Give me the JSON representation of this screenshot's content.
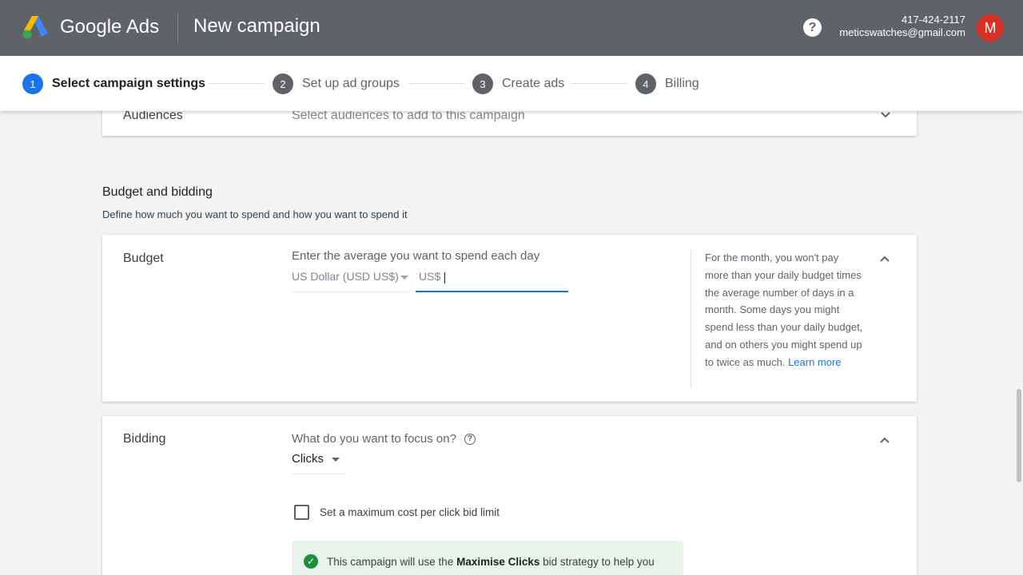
{
  "header": {
    "brand": "Google Ads",
    "page_title": "New campaign",
    "help_symbol": "?",
    "account_phone": "417-424-2117",
    "account_email": "meticswatches@gmail.com",
    "avatar_initial": "M",
    "colors": {
      "topbar": "#5f6368",
      "avatar": "#d93025"
    }
  },
  "stepper": {
    "steps": [
      {
        "number": "1",
        "label": "Select campaign settings",
        "active": true
      },
      {
        "number": "2",
        "label": "Set up ad groups",
        "active": false
      },
      {
        "number": "3",
        "label": "Create ads",
        "active": false
      },
      {
        "number": "4",
        "label": "Billing",
        "active": false
      }
    ],
    "accent": "#1a73e8"
  },
  "audiences": {
    "label": "Audiences",
    "placeholder": "Select audiences to add to this campaign"
  },
  "budget_bidding": {
    "title": "Budget and bidding",
    "subtitle": "Define how much you want to spend and how you want to spend it"
  },
  "budget": {
    "label": "Budget",
    "prompt": "Enter the average you want to spend each day",
    "currency_selected": "US Dollar (USD US$)",
    "input_prefix": "US$",
    "input_value": "",
    "help_text": "For the month, you won't pay more than your daily budget times the average number of days in a month. Some days you might spend less than your daily budget, and on others you might spend up to twice as much.",
    "learn_more": "Learn more"
  },
  "bidding": {
    "label": "Bidding",
    "focus_question": "What do you want to focus on?",
    "focus_help_symbol": "?",
    "focus_selected": "Clicks",
    "max_cpc_label": "Set a maximum cost per click bid limit",
    "max_cpc_checked": false,
    "info_prefix": "This campaign will use the ",
    "info_strategy": "Maximise Clicks",
    "info_suffix": " bid strategy to help you",
    "info_check_symbol": "✓",
    "info_color": "#e6f4ea"
  }
}
